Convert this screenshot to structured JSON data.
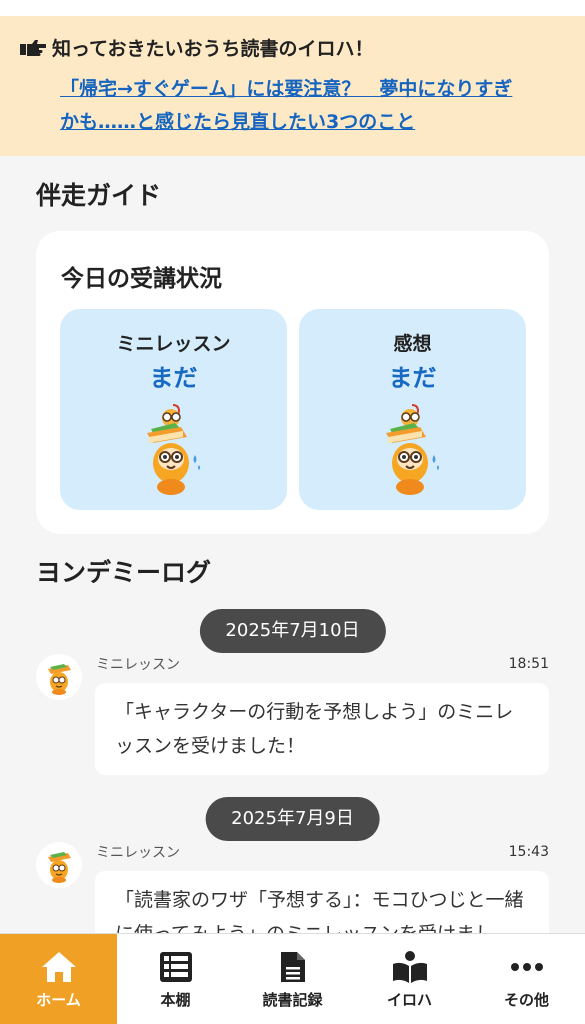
{
  "banner": {
    "title": "知っておきたいおうち読書のイロハ！",
    "link_line1": "「帰宅→すぐゲーム」には要注意？　夢中になりすぎ",
    "link_line2": "かも……と感じたら見直したい3つのこと"
  },
  "guide": {
    "section_title": "伴走ガイド",
    "card_title": "今日の受講状況",
    "tiles": [
      {
        "label": "ミニレッスン",
        "status": "まだ"
      },
      {
        "label": "感想",
        "status": "まだ"
      }
    ]
  },
  "log": {
    "section_title": "ヨンデミーログ",
    "entries": [
      {
        "date": "2025年7月10日",
        "type": "ミニレッスン",
        "time": "18:51",
        "text": "「キャラクターの行動を予想しよう」のミニレッスンを受けました！"
      },
      {
        "date": "2025年7月9日",
        "type": "ミニレッスン",
        "time": "15:43",
        "text": "「読書家のワザ「予想する」：モコひつじと一緒に使ってみよう」のミニレッスンを受けました！"
      }
    ]
  },
  "tabbar": {
    "tabs": [
      {
        "label": "ホーム",
        "icon": "home-icon",
        "active": true
      },
      {
        "label": "本棚",
        "icon": "bookshelf-icon"
      },
      {
        "label": "読書記録",
        "icon": "document-icon"
      },
      {
        "label": "イロハ",
        "icon": "reading-person-icon"
      },
      {
        "label": "その他",
        "icon": "more-icon"
      }
    ]
  },
  "colors": {
    "banner_bg": "#fde9c6",
    "link": "#1565c0",
    "tile_bg": "#d4ecfb",
    "status_blue": "#1769c4",
    "active_tab": "#f0a024",
    "date_chip": "#4a4a4a"
  }
}
